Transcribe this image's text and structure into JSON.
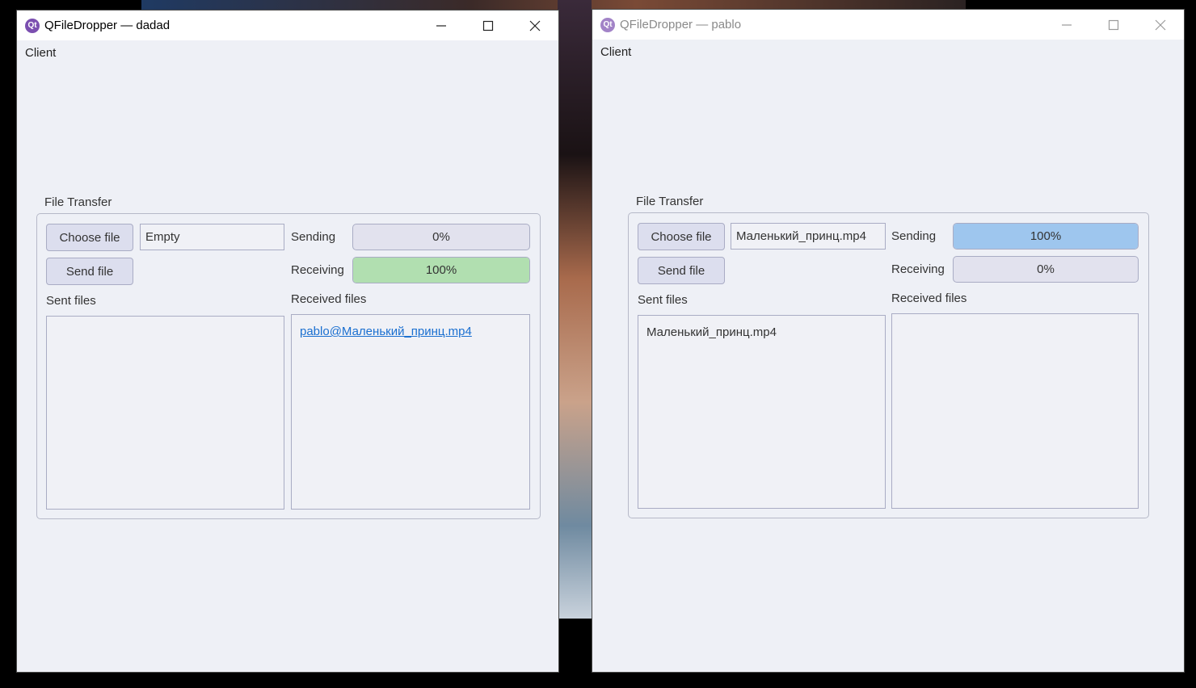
{
  "windows": [
    {
      "title": "QFileDropper — dadad",
      "icon": "qt-icon",
      "client_label": "Client",
      "group_title": "File Transfer",
      "choose_file_label": "Choose file",
      "file_field_value": "Empty",
      "send_file_label": "Send file",
      "sending_label": "Sending",
      "sending_progress": 0,
      "sending_text": "0%",
      "receiving_label": "Receiving",
      "receiving_progress": 100,
      "receiving_text": "100%",
      "sent_files_label": "Sent files",
      "sent_files": [],
      "received_files_label": "Received files",
      "received_files": [
        "pablo@Маленький_принц.mp4"
      ]
    },
    {
      "title": "QFileDropper — pablo",
      "icon": "qt-icon",
      "client_label": "Client",
      "group_title": "File Transfer",
      "choose_file_label": "Choose file",
      "file_field_value": "Маленький_принц.mp4",
      "send_file_label": "Send file",
      "sending_label": "Sending",
      "sending_progress": 100,
      "sending_text": "100%",
      "receiving_label": "Receiving",
      "receiving_progress": 0,
      "receiving_text": "0%",
      "sent_files_label": "Sent files",
      "sent_files": [
        "Маленький_принц.mp4"
      ],
      "received_files_label": "Received files",
      "received_files": []
    }
  ],
  "colors": {
    "sending_fill": "#9ec6ee",
    "receiving_fill": "#b1dfb0",
    "link": "#1a6fd0"
  },
  "titlebar_icons": [
    "minimize-icon",
    "maximize-icon",
    "close-icon"
  ]
}
